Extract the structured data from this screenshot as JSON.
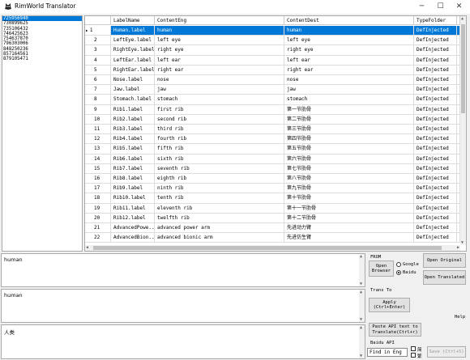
{
  "window": {
    "title": "RimWorld Translator",
    "minimize": "─",
    "maximize": "☐",
    "close": "✕"
  },
  "id_list": [
    "725956940",
    "730899625",
    "735106432",
    "746425623",
    "754637870",
    "796303006",
    "848250236",
    "857164561",
    "879105471"
  ],
  "grid": {
    "columns": [
      "LabelName",
      "ContentEng",
      "ContentDest",
      "TypeFolder"
    ],
    "rows": [
      {
        "n": "1",
        "label": "Human.label",
        "eng": "human",
        "dest": "human",
        "type": "DefInjected"
      },
      {
        "n": "2",
        "label": "LeftEye.label",
        "eng": "left eye",
        "dest": "left eye",
        "type": "DefInjected"
      },
      {
        "n": "3",
        "label": "RightEye.label",
        "eng": "right eye",
        "dest": "right eye",
        "type": "DefInjected"
      },
      {
        "n": "4",
        "label": "LeftEar.label",
        "eng": "left ear",
        "dest": "left ear",
        "type": "DefInjected"
      },
      {
        "n": "5",
        "label": "RightEar.label",
        "eng": "right ear",
        "dest": "right ear",
        "type": "DefInjected"
      },
      {
        "n": "6",
        "label": "Nose.label",
        "eng": "nose",
        "dest": "nose",
        "type": "DefInjected"
      },
      {
        "n": "7",
        "label": "Jaw.label",
        "eng": "jaw",
        "dest": "jaw",
        "type": "DefInjected"
      },
      {
        "n": "8",
        "label": "Stomach.label",
        "eng": "stomach",
        "dest": "stomach",
        "type": "DefInjected"
      },
      {
        "n": "9",
        "label": "Rib1.label",
        "eng": "first rib",
        "dest": "第一节肋骨",
        "type": "DefInjected"
      },
      {
        "n": "10",
        "label": "Rib2.label",
        "eng": "second rib",
        "dest": "第二节肋骨",
        "type": "DefInjected"
      },
      {
        "n": "11",
        "label": "Rib3.label",
        "eng": "third rib",
        "dest": "第三节肋骨",
        "type": "DefInjected"
      },
      {
        "n": "12",
        "label": "Rib4.label",
        "eng": "fourth rib",
        "dest": "第四节肋骨",
        "type": "DefInjected"
      },
      {
        "n": "13",
        "label": "Rib5.label",
        "eng": "fifth rib",
        "dest": "第五节肋骨",
        "type": "DefInjected"
      },
      {
        "n": "14",
        "label": "Rib6.label",
        "eng": "sixth rib",
        "dest": "第六节肋骨",
        "type": "DefInjected"
      },
      {
        "n": "15",
        "label": "Rib7.label",
        "eng": "seventh rib",
        "dest": "第七节肋骨",
        "type": "DefInjected"
      },
      {
        "n": "16",
        "label": "Rib8.label",
        "eng": "eighth rib",
        "dest": "第八节肋骨",
        "type": "DefInjected"
      },
      {
        "n": "17",
        "label": "Rib9.label",
        "eng": "ninth rib",
        "dest": "第九节肋骨",
        "type": "DefInjected"
      },
      {
        "n": "18",
        "label": "Rib10.label",
        "eng": "tenth rib",
        "dest": "第十节肋骨",
        "type": "DefInjected"
      },
      {
        "n": "19",
        "label": "Rib11.label",
        "eng": "eleventh rib",
        "dest": "第十一节肋骨",
        "type": "DefInjected"
      },
      {
        "n": "20",
        "label": "Rib12.label",
        "eng": "twelfth rib",
        "dest": "第十二节肋骨",
        "type": "DefInjected"
      },
      {
        "n": "21",
        "label": "AdvancedPowe...",
        "eng": "advanced power arm",
        "dest": "先进动力臂",
        "type": "DefInjected"
      },
      {
        "n": "22",
        "label": "AdvancedBion...",
        "eng": "advanced bionic arm",
        "dest": "先进仿生臂",
        "type": "DefInjected"
      }
    ]
  },
  "text_eng": "human",
  "text_dest": "human",
  "text_api": "人类",
  "panel": {
    "from_label": "FROM",
    "open_browser": "Open\nBrowser",
    "google": "Google",
    "baidu": "Baidu",
    "open_original": "Open Original",
    "open_translated": "Open Translated",
    "trans_to": "Trans To",
    "apply": "Apply\n(Ctrl+Enter)",
    "help": "Help",
    "paste_api": "Paste API text to\nTranslate(Ctrl+↑)",
    "baidu_api": "Baidu API",
    "find_in_eng": "Find in Eng",
    "chk1": "简",
    "chk2": "繁",
    "save": "Save (Ctrl+S)"
  },
  "colors": {
    "selection": "#0078d7"
  }
}
